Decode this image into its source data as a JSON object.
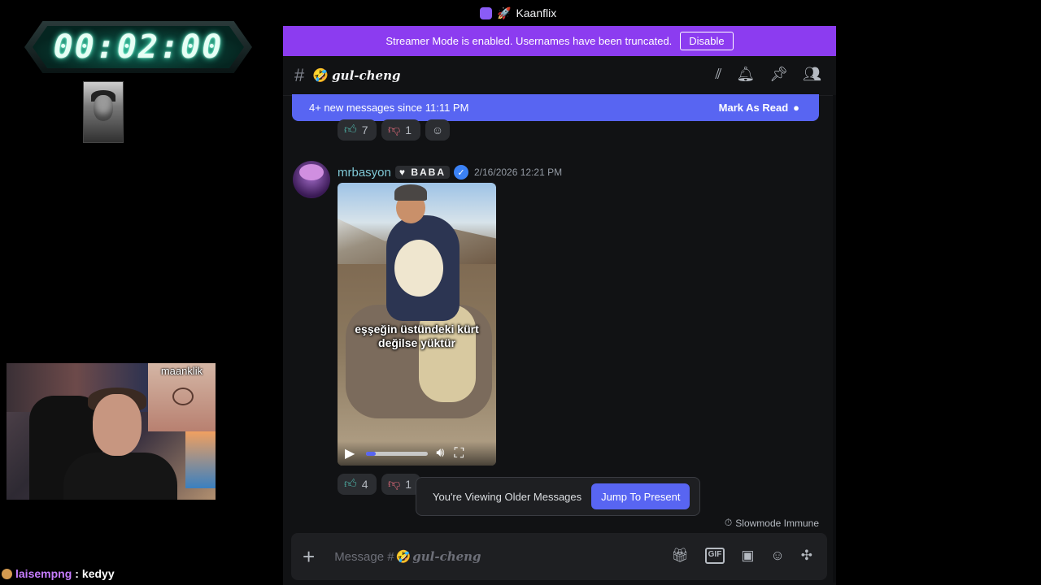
{
  "window": {
    "title": "Kaanflix"
  },
  "overlay": {
    "timer": "00:02:00",
    "webcam_label": "maanklik",
    "chat": {
      "user": "laisempng",
      "separator": ":",
      "message": "kedyy"
    }
  },
  "discord": {
    "streamer_banner": {
      "text": "Streamer Mode is enabled. Usernames have been truncated.",
      "button": "Disable"
    },
    "channel": {
      "emoji": "🤣",
      "name": "gul-cheng"
    },
    "header_icons": [
      "threads-icon",
      "bell-icon",
      "pin-icon",
      "members-icon"
    ],
    "new_messages": {
      "text": "4+ new messages since 11:11 PM",
      "action": "Mark As Read"
    },
    "top_reactions": [
      {
        "icon": "thumbs-up-icon",
        "count": "7"
      },
      {
        "icon": "thumbs-down-icon",
        "count": "1"
      }
    ],
    "message": {
      "username": "mrbasyon",
      "tag": "BABA",
      "timestamp": "2/16/2026 12:21 PM",
      "video_caption": "eşşeğin üstündeki kürt\ndeğilse yüktür",
      "video_progress": 0.15
    },
    "bottom_reactions": [
      {
        "icon": "thumbs-up-icon",
        "count": "4"
      },
      {
        "icon": "thumbs-down-icon",
        "count": "1"
      }
    ],
    "older_messages": {
      "text": "You're Viewing Older Messages",
      "button": "Jump To Present"
    },
    "slowmode": "Slowmode Immune",
    "composer": {
      "placeholder_prefix": "Message #",
      "channel_emoji": "🤣",
      "channel_name": "gul-cheng"
    },
    "composer_icons": [
      "gift-icon",
      "gif-icon",
      "sticker-icon",
      "emoji-icon",
      "apps-icon"
    ]
  }
}
